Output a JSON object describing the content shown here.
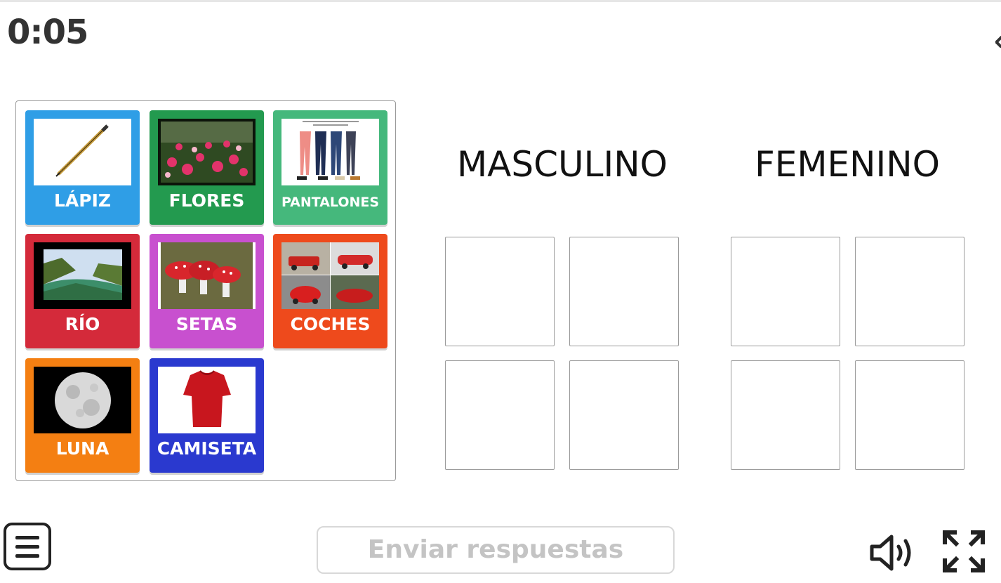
{
  "timer": "0:05",
  "cards": [
    {
      "label": "LÁPIZ",
      "color": "#2f9ee6",
      "icon": "pencil-image"
    },
    {
      "label": "FLORES",
      "color": "#239a4f",
      "icon": "flowers-image"
    },
    {
      "label": "PANTALONES",
      "color": "#45b87c",
      "icon": "pants-image"
    },
    {
      "label": "RÍO",
      "color": "#d42a3a",
      "icon": "river-image"
    },
    {
      "label": "SETAS",
      "color": "#c850cf",
      "icon": "mushrooms-image"
    },
    {
      "label": "COCHES",
      "color": "#ee4a1c",
      "icon": "cars-image"
    },
    {
      "label": "LUNA",
      "color": "#f47f12",
      "icon": "moon-image"
    },
    {
      "label": "CAMISETA",
      "color": "#2a39cf",
      "icon": "tshirt-image"
    }
  ],
  "categories": [
    {
      "title": "MASCULINO"
    },
    {
      "title": "FEMENINO"
    }
  ],
  "submit_label": "Enviar respuestas",
  "icons": {
    "menu": "menu-icon",
    "sound": "speaker-icon",
    "fullscreen": "fullscreen-icon"
  }
}
